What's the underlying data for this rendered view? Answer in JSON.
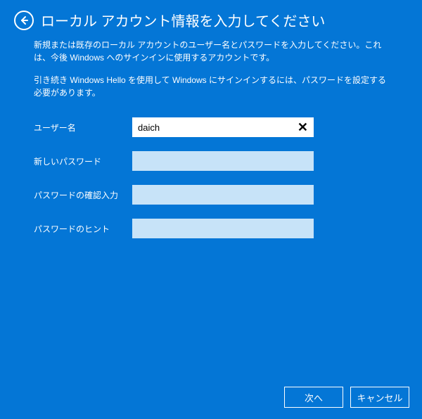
{
  "header": {
    "title": "ローカル アカウント情報を入力してください"
  },
  "paragraphs": {
    "p1": "新規または既存のローカル アカウントのユーザー名とパスワードを入力してください。これは、今後 Windows へのサインインに使用するアカウントです。",
    "p2": "引き続き Windows Hello を使用して Windows にサインインするには、パスワードを設定する必要があります。"
  },
  "form": {
    "username": {
      "label": "ユーザー名",
      "value": "daich"
    },
    "password": {
      "label": "新しいパスワード",
      "value": ""
    },
    "confirm": {
      "label": "パスワードの確認入力",
      "value": ""
    },
    "hint": {
      "label": "パスワードのヒント",
      "value": ""
    },
    "clear_symbol": "✕"
  },
  "footer": {
    "next": "次へ",
    "cancel": "キャンセル"
  }
}
